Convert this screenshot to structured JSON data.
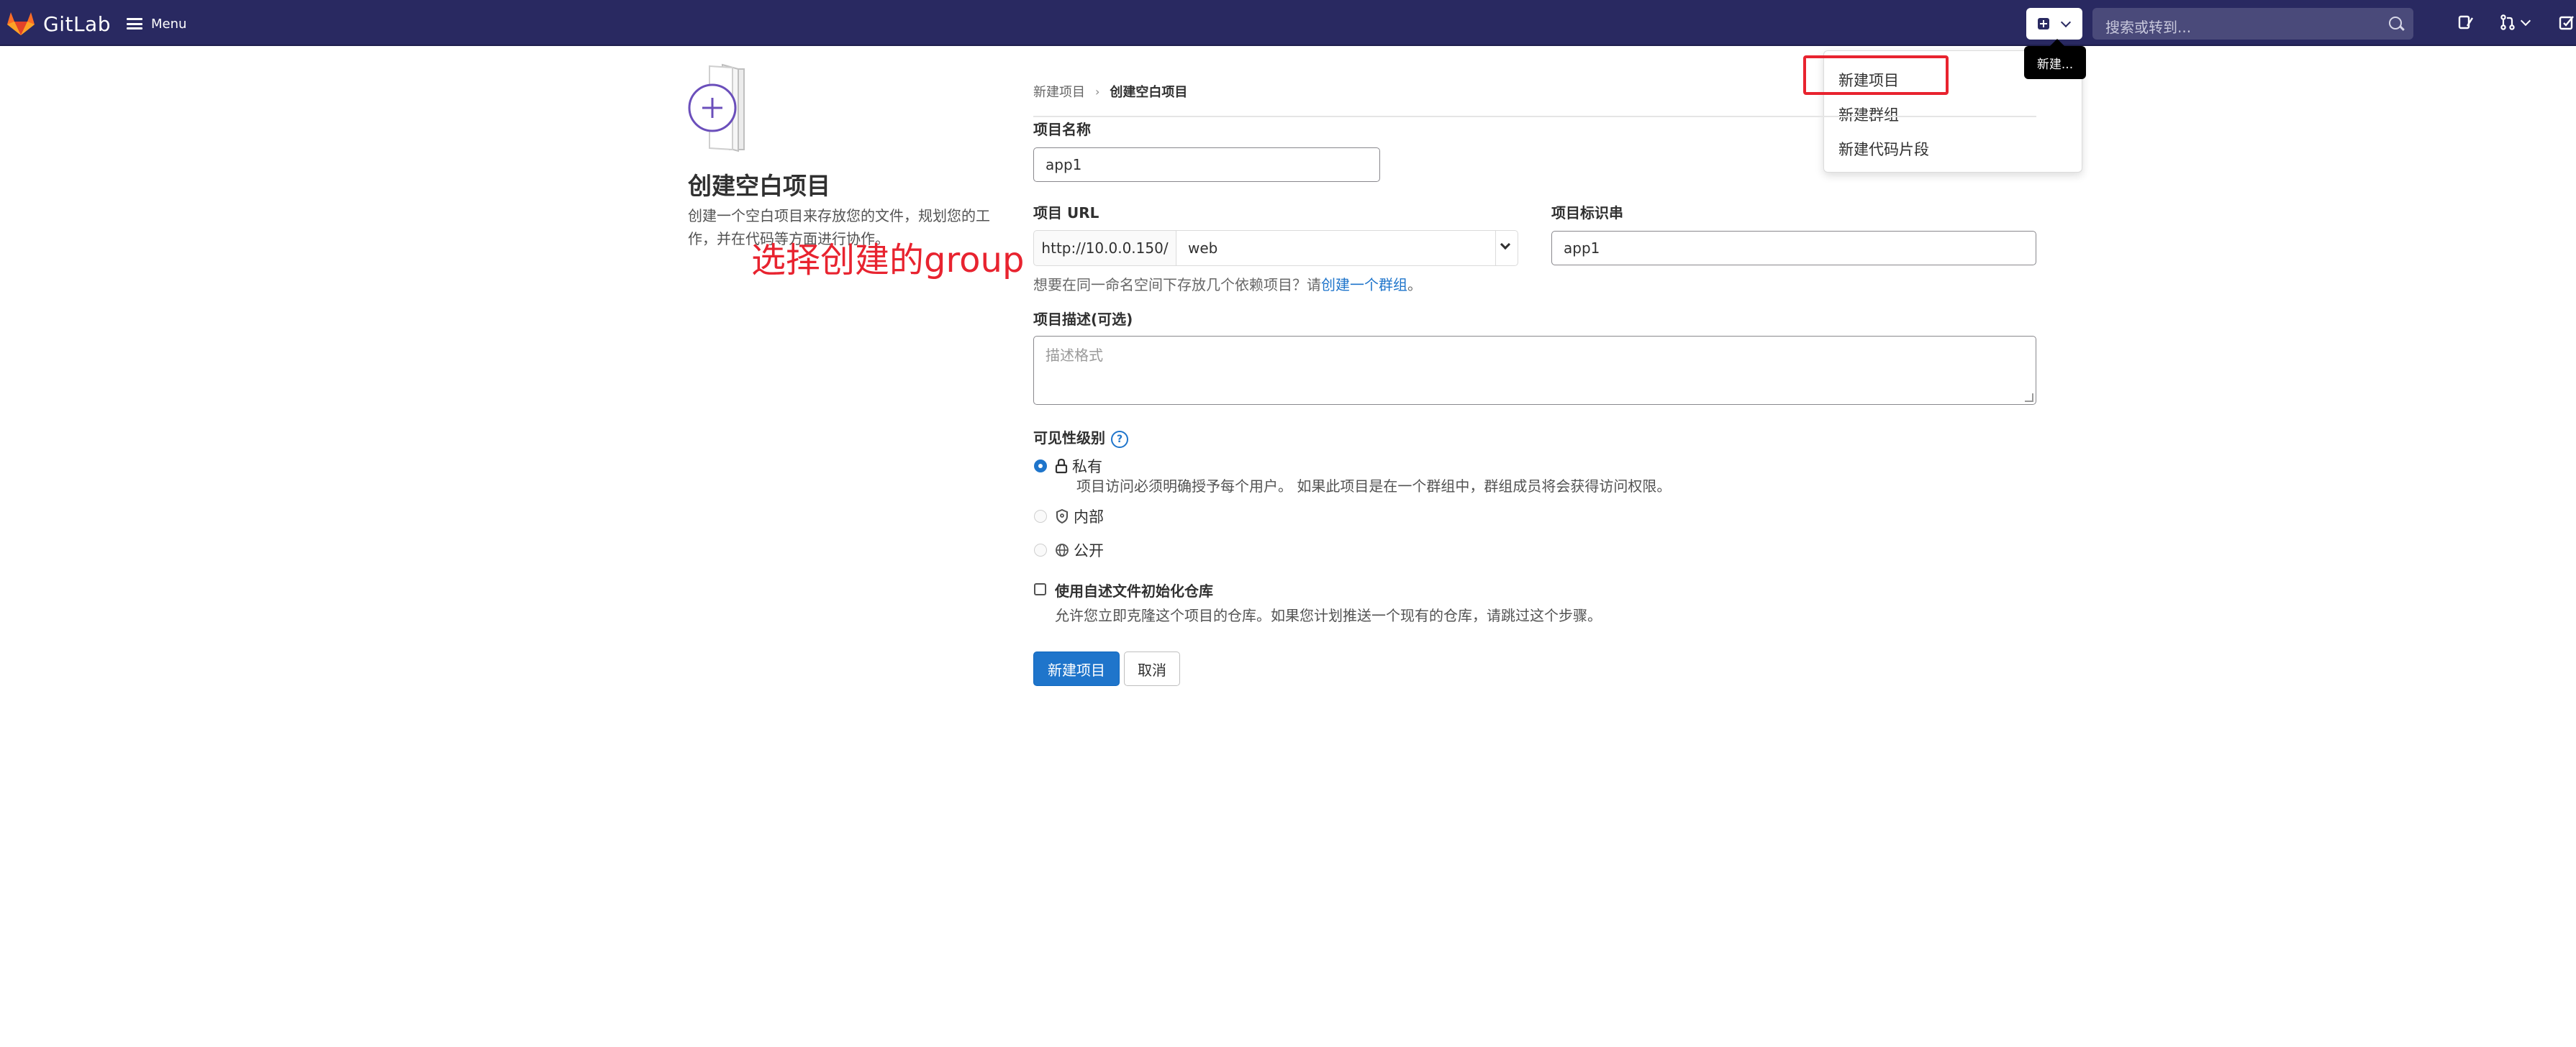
{
  "header": {
    "brand": "GitLab",
    "menu_label": "Menu",
    "search_placeholder": "搜索或转到...",
    "new_tooltip": "新建..."
  },
  "new_dropdown": {
    "items": [
      {
        "label": "新建项目",
        "highlighted": true
      },
      {
        "label": "新建群组"
      },
      {
        "label": "新建代码片段"
      }
    ]
  },
  "left_panel": {
    "title": "创建空白项目",
    "description": "创建一个空白项目来存放您的文件，规划您的工作，并在代码等方面进行协作。"
  },
  "annotation": "选择创建的group",
  "breadcrumb": {
    "items": [
      "新建项目",
      "创建空白项目"
    ],
    "separator": "›"
  },
  "form": {
    "project_name_label": "项目名称",
    "project_name_value": "app1",
    "project_url_label": "项目 URL",
    "url_prefix": "http://10.0.0.150/",
    "url_namespace": "web",
    "project_slug_label": "项目标识串",
    "project_slug_value": "app1",
    "hint_text": "想要在同一命名空间下存放几个依赖项目？请",
    "hint_link": "创建一个群组",
    "hint_end": "。",
    "description_label": "项目描述(可选)",
    "description_placeholder": "描述格式",
    "visibility_label": "可见性级别",
    "visibility_help": "?",
    "visibility_options": [
      {
        "label": "私有",
        "description": "项目访问必须明确授予每个用户。 如果此项目是在一个群组中，群组成员将会获得访问权限。",
        "selected": true
      },
      {
        "label": "内部",
        "selected": false
      },
      {
        "label": "公开",
        "selected": false
      }
    ],
    "init_readme_label": "使用自述文件初始化仓库",
    "init_readme_description": "允许您立即克隆这个项目的仓库。如果您计划推送一个现有的仓库，请跳过这个步骤。",
    "init_readme_checked": false,
    "submit_label": "新建项目",
    "cancel_label": "取消"
  },
  "colors": {
    "topbar": "#292961",
    "primary": "#1f75cb",
    "annotation": "#e8232f"
  }
}
